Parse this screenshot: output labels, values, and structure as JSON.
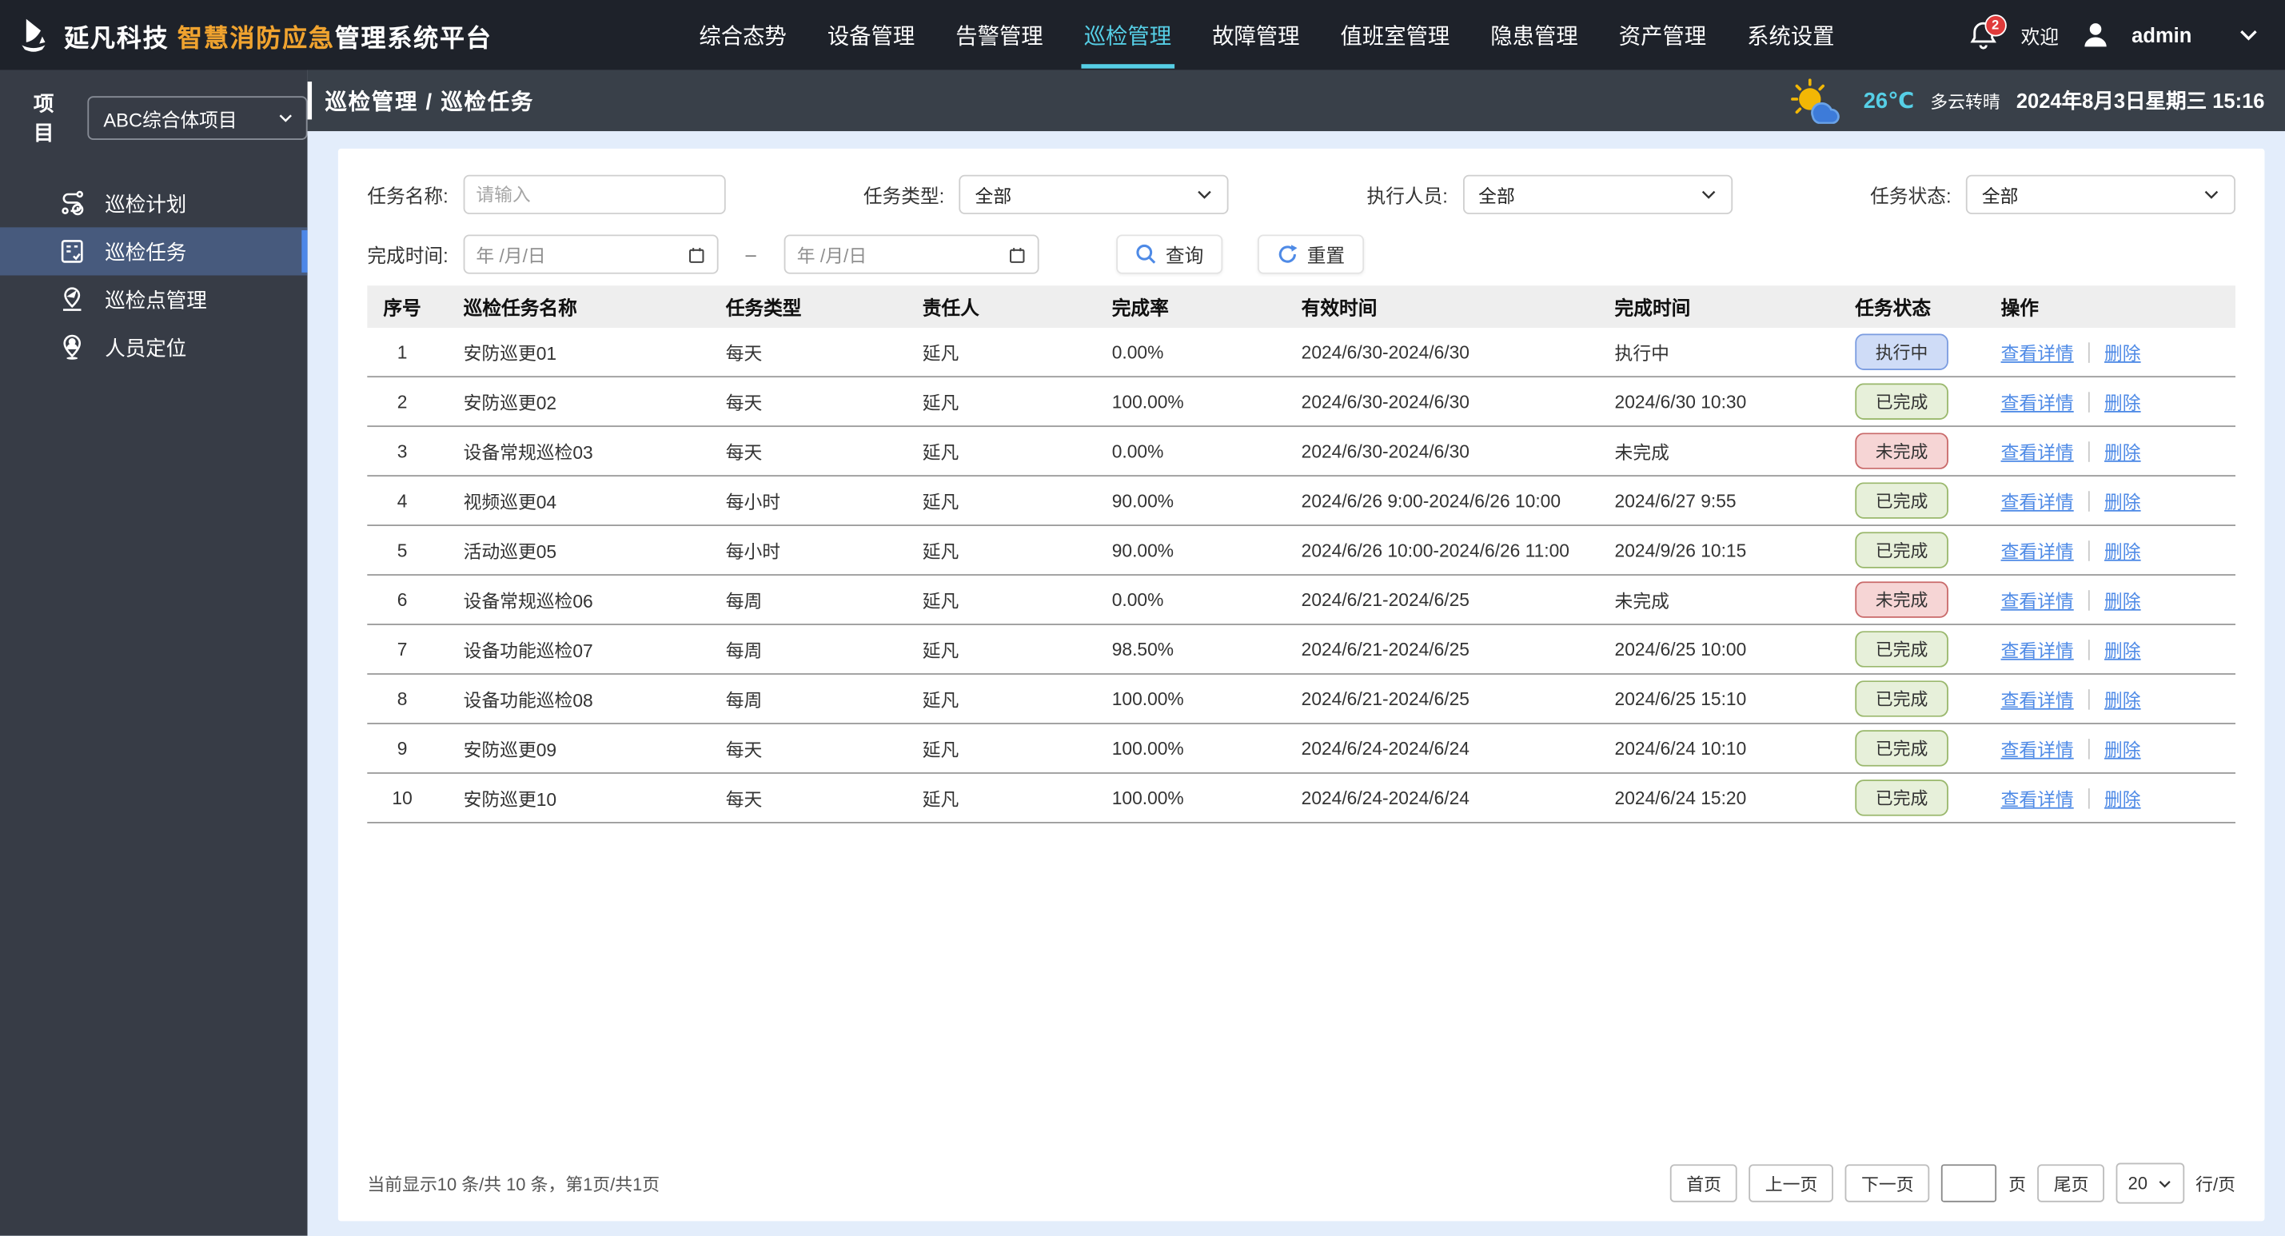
{
  "topbar": {
    "brand_name": "延凡科技",
    "brand_highlight": "智慧消防应急",
    "brand_suffix": "管理系统平台",
    "nav": [
      {
        "label": "综合态势",
        "active": false
      },
      {
        "label": "设备管理",
        "active": false
      },
      {
        "label": "告警管理",
        "active": false
      },
      {
        "label": "巡检管理",
        "active": true
      },
      {
        "label": "故障管理",
        "active": false
      },
      {
        "label": "值班室管理",
        "active": false
      },
      {
        "label": "隐患管理",
        "active": false
      },
      {
        "label": "资产管理",
        "active": false
      },
      {
        "label": "系统设置",
        "active": false
      }
    ],
    "notification_count": "2",
    "welcome": "欢迎",
    "username": "admin"
  },
  "sidebar": {
    "project_label": "项目",
    "project_value": "ABC综合体项目",
    "items": [
      {
        "label": "巡检计划",
        "icon": "patrol-plan-icon",
        "active": false
      },
      {
        "label": "巡检任务",
        "icon": "patrol-task-icon",
        "active": true
      },
      {
        "label": "巡检点管理",
        "icon": "patrol-point-icon",
        "active": false
      },
      {
        "label": "人员定位",
        "icon": "person-locate-icon",
        "active": false
      }
    ]
  },
  "header": {
    "breadcrumb": "巡检管理 / 巡检任务",
    "temperature": "26℃",
    "weather": "多云转晴",
    "datetime": "2024年8月3日星期三 15:16"
  },
  "filters": {
    "task_name_label": "任务名称:",
    "task_name_placeholder": "请输入",
    "task_type_label": "任务类型:",
    "task_type_value": "全部",
    "executor_label": "执行人员:",
    "executor_value": "全部",
    "status_label": "任务状态:",
    "status_value": "全部",
    "finish_time_label": "完成时间:",
    "date_placeholder": "年 /月/日",
    "range_dash": "–",
    "query_button": "查询",
    "reset_button": "重置"
  },
  "table": {
    "columns": [
      "序号",
      "巡检任务名称",
      "任务类型",
      "责任人",
      "完成率",
      "有效时间",
      "完成时间",
      "任务状态",
      "操作"
    ],
    "ops": {
      "view": "查看详情",
      "delete": "删除"
    },
    "rows": [
      {
        "no": "1",
        "name": "安防巡更01",
        "type": "每天",
        "owner": "延凡",
        "rate": "0.00%",
        "valid": "2024/6/30-2024/6/30",
        "finish": "执行中",
        "status": "执行中",
        "kind": "blue"
      },
      {
        "no": "2",
        "name": "安防巡更02",
        "type": "每天",
        "owner": "延凡",
        "rate": "100.00%",
        "valid": "2024/6/30-2024/6/30",
        "finish": "2024/6/30 10:30",
        "status": "已完成",
        "kind": "green"
      },
      {
        "no": "3",
        "name": "设备常规巡检03",
        "type": "每天",
        "owner": "延凡",
        "rate": "0.00%",
        "valid": "2024/6/30-2024/6/30",
        "finish": "未完成",
        "status": "未完成",
        "kind": "red"
      },
      {
        "no": "4",
        "name": "视频巡更04",
        "type": "每小时",
        "owner": "延凡",
        "rate": "90.00%",
        "valid": "2024/6/26 9:00-2024/6/26 10:00",
        "finish": "2024/6/27 9:55",
        "status": "已完成",
        "kind": "green"
      },
      {
        "no": "5",
        "name": "活动巡更05",
        "type": "每小时",
        "owner": "延凡",
        "rate": "90.00%",
        "valid": "2024/6/26 10:00-2024/6/26 11:00",
        "finish": "2024/9/26 10:15",
        "status": "已完成",
        "kind": "green"
      },
      {
        "no": "6",
        "name": "设备常规巡检06",
        "type": "每周",
        "owner": "延凡",
        "rate": "0.00%",
        "valid": "2024/6/21-2024/6/25",
        "finish": "未完成",
        "status": "未完成",
        "kind": "red"
      },
      {
        "no": "7",
        "name": "设备功能巡检07",
        "type": "每周",
        "owner": "延凡",
        "rate": "98.50%",
        "valid": "2024/6/21-2024/6/25",
        "finish": "2024/6/25 10:00",
        "status": "已完成",
        "kind": "green"
      },
      {
        "no": "8",
        "name": "设备功能巡检08",
        "type": "每周",
        "owner": "延凡",
        "rate": "100.00%",
        "valid": "2024/6/21-2024/6/25",
        "finish": "2024/6/25 15:10",
        "status": "已完成",
        "kind": "green"
      },
      {
        "no": "9",
        "name": "安防巡更09",
        "type": "每天",
        "owner": "延凡",
        "rate": "100.00%",
        "valid": "2024/6/24-2024/6/24",
        "finish": "2024/6/24 10:10",
        "status": "已完成",
        "kind": "green"
      },
      {
        "no": "10",
        "name": "安防巡更10",
        "type": "每天",
        "owner": "延凡",
        "rate": "100.00%",
        "valid": "2024/6/24-2024/6/24",
        "finish": "2024/6/24 15:20",
        "status": "已完成",
        "kind": "green"
      }
    ]
  },
  "pagination": {
    "summary": "当前显示10 条/共 10 条，第1页/共1页",
    "first": "首页",
    "prev": "上一页",
    "next": "下一页",
    "page_word": "页",
    "last": "尾页",
    "page_size": "20",
    "per_page": "行/页"
  },
  "colors": {
    "topbar_bg": "#1e222a",
    "sidebar_bg": "#373c46",
    "header_bg": "#394049",
    "accent_cyan": "#56cfe6",
    "brand_orange": "#f0a32f",
    "content_bg": "#e3edfb",
    "link_blue": "#4e8ae6",
    "active_item_bg": "#475a7d",
    "active_indicator": "#4c87e8",
    "badge_running_bg": "#cfdcf7",
    "badge_running_border": "#7b9ce0",
    "badge_done_bg": "#e7f0da",
    "badge_done_border": "#9ab86d",
    "badge_undone_bg": "#f6d5d5",
    "badge_undone_border": "#c96a6a"
  }
}
